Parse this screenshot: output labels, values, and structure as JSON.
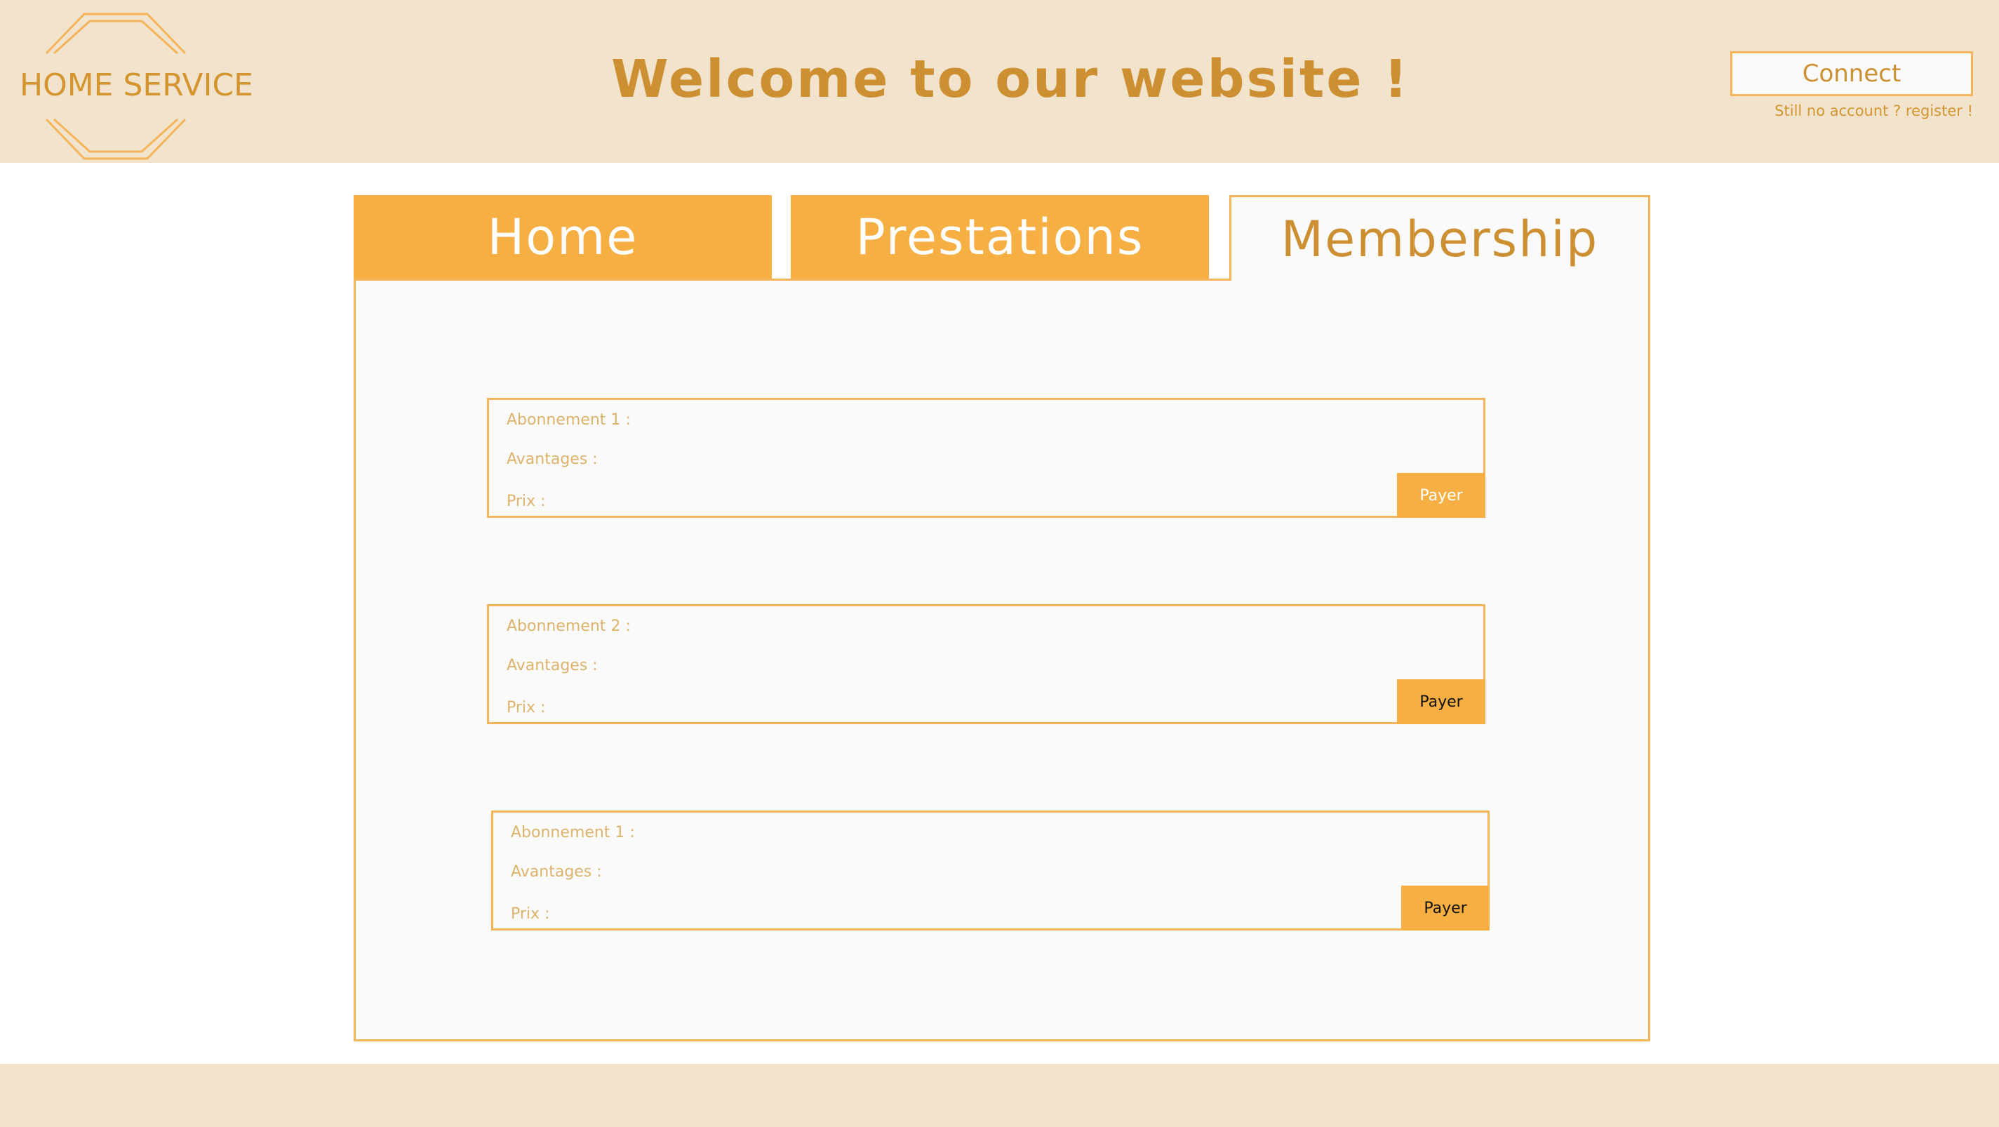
{
  "header": {
    "logo_text": "HOME SERVICE",
    "title": "Welcome to our website !",
    "connect_label": "Connect",
    "register_text": "Still no account ? register !"
  },
  "tabs": [
    {
      "label": "Home",
      "active": false
    },
    {
      "label": "Prestations",
      "active": false
    },
    {
      "label": "Membership",
      "active": true
    }
  ],
  "subscriptions": [
    {
      "name_label": "Abonnement 1 :",
      "advantages_label": "Avantages :",
      "price_label": "Prix :",
      "button_label": "Payer"
    },
    {
      "name_label": "Abonnement 2 :",
      "advantages_label": "Avantages :",
      "price_label": "Prix :",
      "button_label": "Payer"
    },
    {
      "name_label": "Abonnement 1 :",
      "advantages_label": "Avantages :",
      "price_label": "Prix :",
      "button_label": "Payer"
    }
  ],
  "colors": {
    "header_bg": "#f2e3cc",
    "accent_orange": "#f6af42",
    "title_text": "#cc9032",
    "panel_bg": "#fafafa"
  },
  "icons": [
    "hexagon-logo-icon"
  ]
}
